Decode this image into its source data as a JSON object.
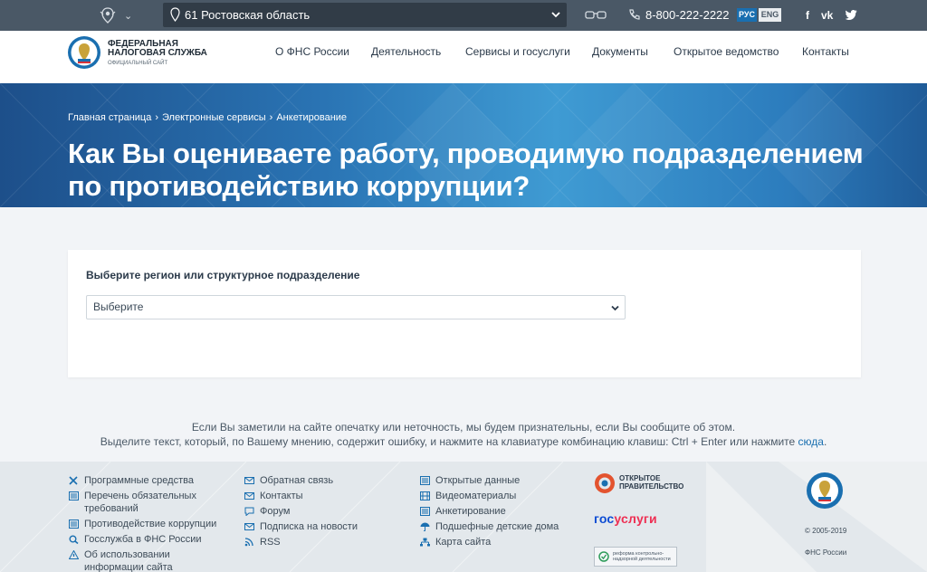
{
  "topbar": {
    "region": "61 Ростовская область",
    "phone": "8-800-222-2222",
    "lang_ru": "РУС",
    "lang_en": "ENG",
    "social": [
      "f",
      "vk",
      "tw"
    ]
  },
  "header": {
    "logo_line1": "ФЕДЕРАЛЬНАЯ",
    "logo_line2": "НАЛОГОВАЯ СЛУЖБА",
    "logo_line3": "ОФИЦИАЛЬНЫЙ САЙТ",
    "nav": [
      "О ФНС России",
      "Деятельность",
      "Сервисы и госуслуги",
      "Документы",
      "Открытое ведомство",
      "Контакты"
    ]
  },
  "hero": {
    "breadcrumbs": [
      "Главная страница",
      "Электронные сервисы",
      "Анкетирование"
    ],
    "title": "Как Вы оцениваете работу, проводимую подразделением по противодействию коррупции?"
  },
  "form": {
    "label": "Выберите регион или структурное подразделение",
    "select_value": "Выберите"
  },
  "notice": {
    "line1": "Если Вы заметили на сайте опечатку или неточность, мы будем признательны, если Вы сообщите об этом.",
    "line2_prefix": "Выделите текст, который, по Вашему мнению, содержит ошибку, и нажмите на клавиатуре комбинацию клавиш: Ctrl + Enter или нажмите ",
    "link": "сюда",
    "line2_suffix": "."
  },
  "footer": {
    "col1": [
      {
        "label": "Программные средства",
        "icon": "tools-icon"
      },
      {
        "label": "Перечень обязательных требований",
        "icon": "list-icon"
      },
      {
        "label": "Противодействие коррупции",
        "icon": "list-icon"
      },
      {
        "label": "Госслужба в ФНС России",
        "icon": "search-icon"
      },
      {
        "label": "Об использовании информации сайта",
        "icon": "info-icon"
      }
    ],
    "col2": [
      {
        "label": "Обратная связь",
        "icon": "mail-icon"
      },
      {
        "label": "Контакты",
        "icon": "mail-icon"
      },
      {
        "label": "Форум",
        "icon": "chat-icon"
      },
      {
        "label": "Подписка на новости",
        "icon": "mail-icon"
      },
      {
        "label": "RSS",
        "icon": "rss-icon"
      }
    ],
    "col3": [
      {
        "label": "Открытые данные",
        "icon": "list-icon"
      },
      {
        "label": "Видеоматериалы",
        "icon": "film-icon"
      },
      {
        "label": "Анкетирование",
        "icon": "list-icon"
      },
      {
        "label": "Подшефные детские дома",
        "icon": "umbrella-icon"
      },
      {
        "label": "Карта сайта",
        "icon": "sitemap-icon"
      }
    ],
    "open_gov_line1": "ОТКРЫТОЕ",
    "open_gov_line2": "ПРАВИТЕЛЬСТВО",
    "gosuslugi_a": "гос",
    "gosuslugi_b": "услуги",
    "reform": "реформа контрольно-надзорной деятельности",
    "copyright": "© 2005-2019",
    "org": "ФНС России"
  },
  "colors": {
    "topbar": "#4a5866",
    "accent": "#1a6fb0",
    "gos_blue": "#0d4cd3",
    "gos_red": "#ee2f53"
  }
}
